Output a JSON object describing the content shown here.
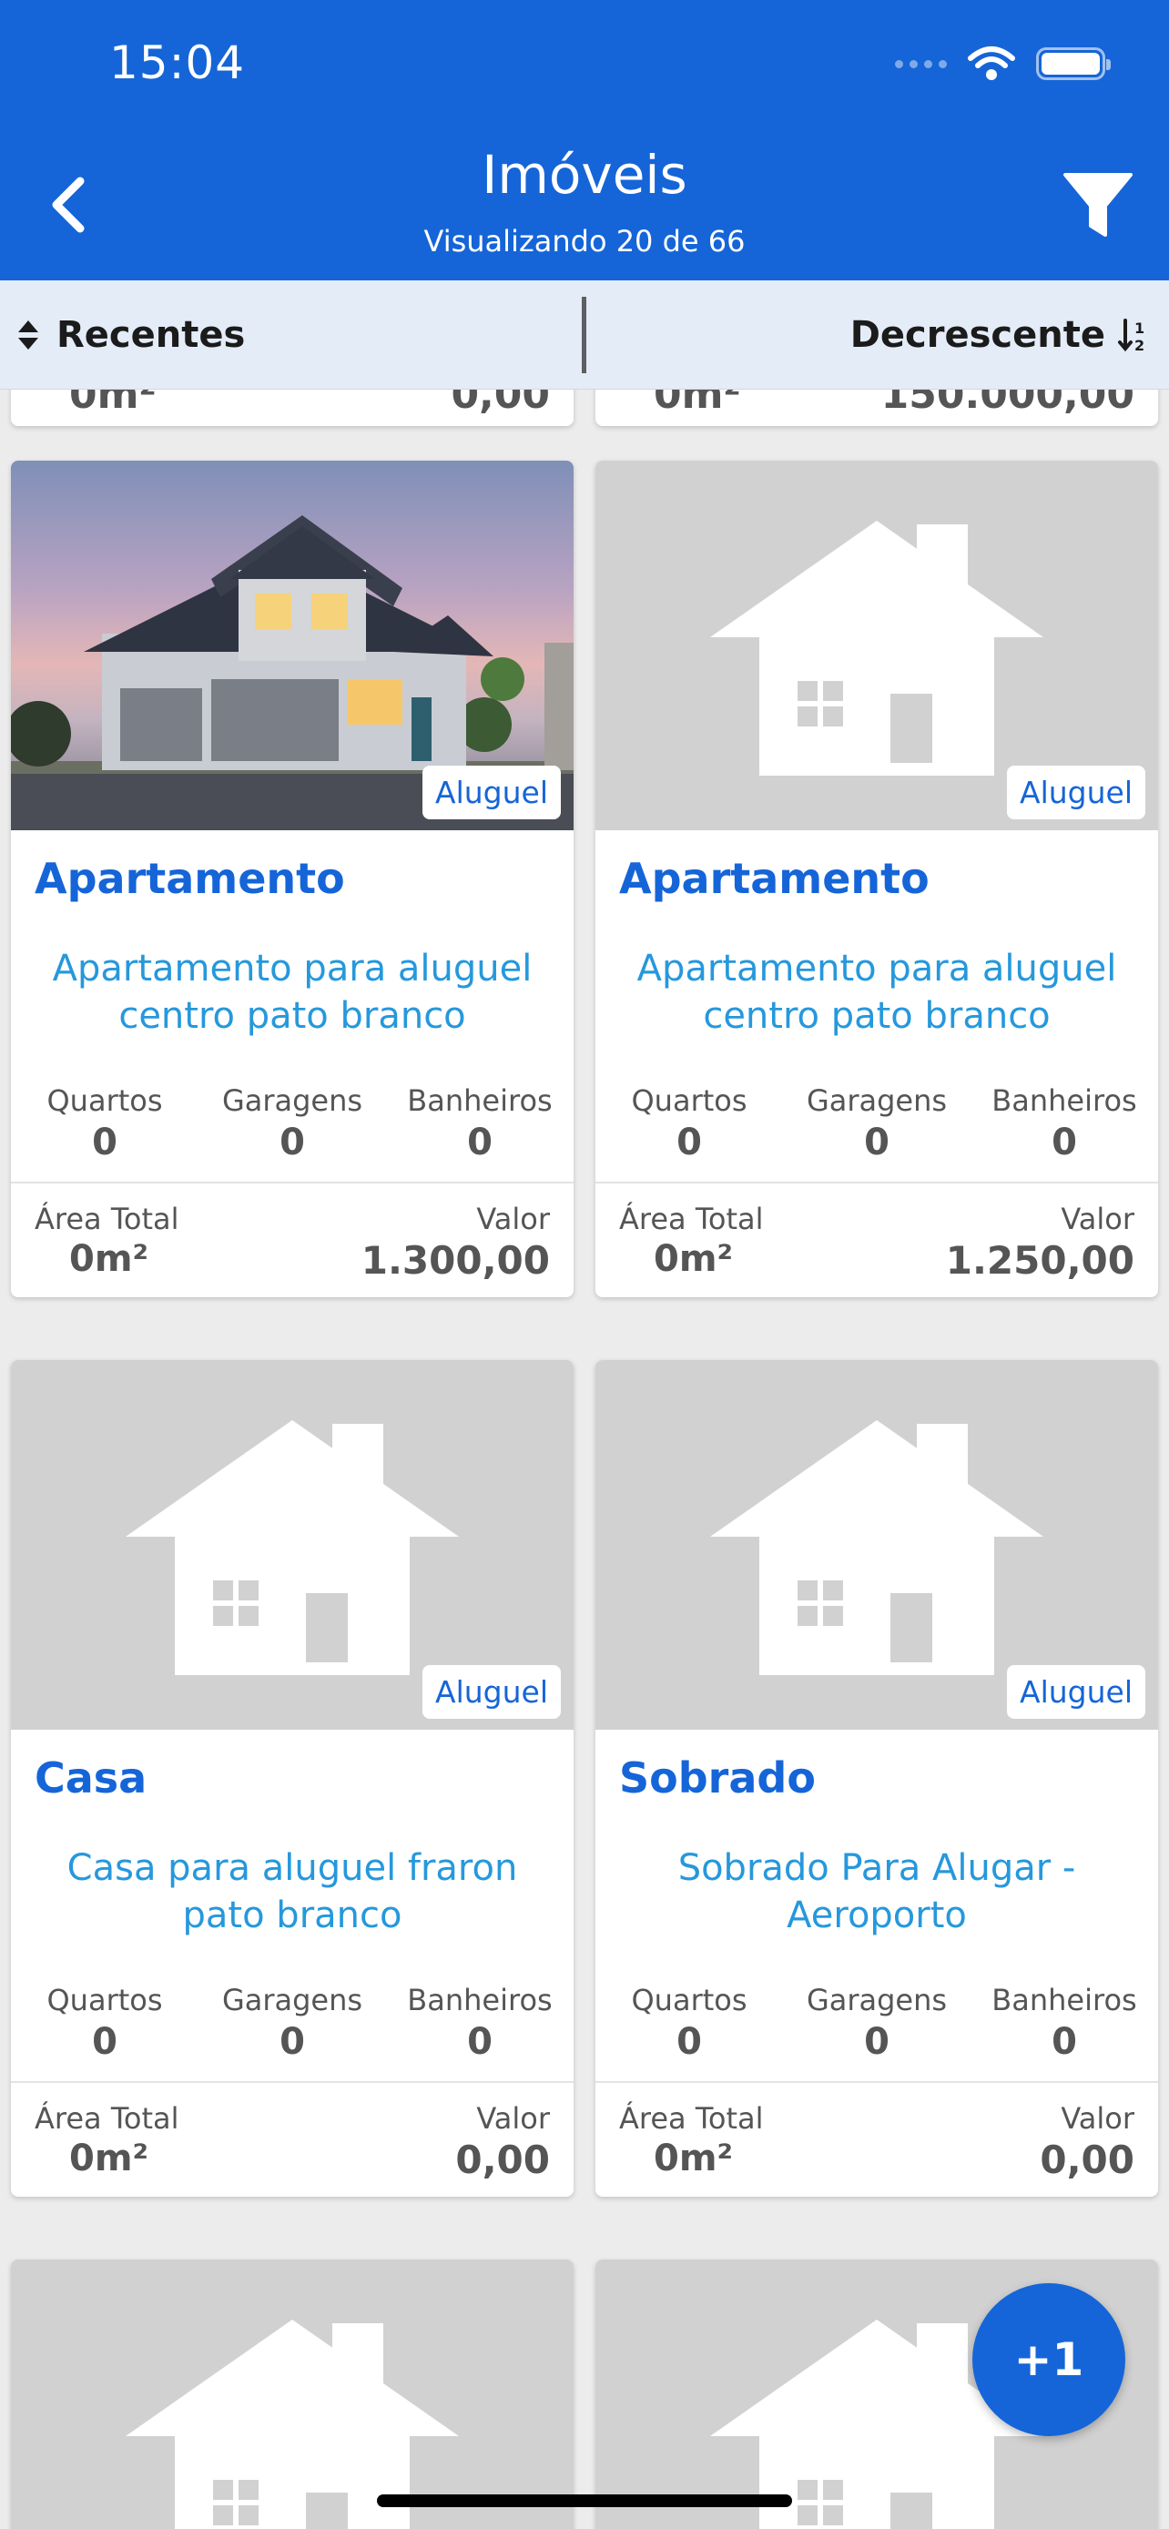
{
  "status_bar": {
    "time": "15:04"
  },
  "header": {
    "title": "Imóveis",
    "subtitle": "Visualizando 20 de 66"
  },
  "sort": {
    "field": "Recentes",
    "order": "Decrescente"
  },
  "partial_cards": [
    {
      "area": "0m²",
      "value": "0,00"
    },
    {
      "area": "0m²",
      "value": "150.000,00"
    }
  ],
  "labels": {
    "bedrooms": "Quartos",
    "garages": "Garagens",
    "bathrooms": "Banheiros",
    "total_area": "Área Total",
    "value": "Valor"
  },
  "cards": [
    {
      "badge": "Aluguel",
      "type": "Apartamento",
      "description": "Apartamento para aluguel centro pato branco",
      "bedrooms": "0",
      "garages": "0",
      "bathrooms": "0",
      "area": "0m²",
      "value": "1.300,00",
      "image": "house-photo"
    },
    {
      "badge": "Aluguel",
      "type": "Apartamento",
      "description": "Apartamento para aluguel centro pato branco",
      "bedrooms": "0",
      "garages": "0",
      "bathrooms": "0",
      "area": "0m²",
      "value": "1.250,00",
      "image": "house-placeholder-icon"
    },
    {
      "badge": "Aluguel",
      "type": "Casa",
      "description": "Casa para aluguel  fraron pato branco",
      "bedrooms": "0",
      "garages": "0",
      "bathrooms": "0",
      "area": "0m²",
      "value": "0,00",
      "image": "house-placeholder-icon"
    },
    {
      "badge": "Aluguel",
      "type": "Sobrado",
      "description": "Sobrado Para Alugar - Aeroporto",
      "bedrooms": "0",
      "garages": "0",
      "bathrooms": "0",
      "area": "0m²",
      "value": "0,00",
      "image": "house-placeholder-icon"
    }
  ],
  "fab": {
    "label": "+1"
  },
  "colors": {
    "primary": "#1565d8",
    "accent_text": "#2698dc",
    "sort_bar": "#e4ecf7",
    "placeholder": "#d1d1d1"
  }
}
